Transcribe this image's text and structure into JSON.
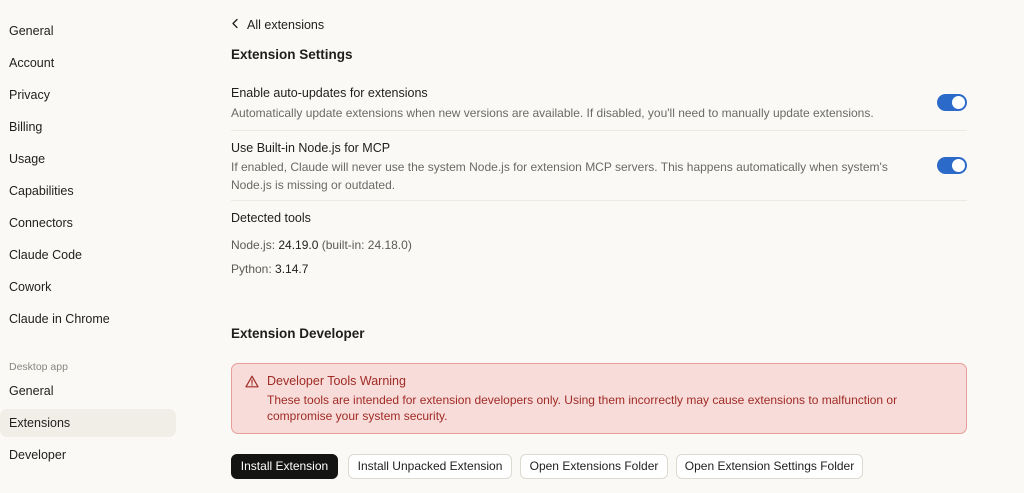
{
  "sidebar": {
    "items": [
      {
        "label": "General"
      },
      {
        "label": "Account"
      },
      {
        "label": "Privacy"
      },
      {
        "label": "Billing"
      },
      {
        "label": "Usage"
      },
      {
        "label": "Capabilities"
      },
      {
        "label": "Connectors"
      },
      {
        "label": "Claude Code"
      },
      {
        "label": "Cowork"
      },
      {
        "label": "Claude in Chrome"
      }
    ],
    "desktop_section_label": "Desktop app",
    "desktop_items": [
      {
        "label": "General"
      },
      {
        "label": "Extensions",
        "active": true
      },
      {
        "label": "Developer"
      }
    ]
  },
  "main": {
    "back_label": "All extensions",
    "settings_heading": "Extension Settings",
    "auto_updates": {
      "title": "Enable auto-updates for extensions",
      "description": "Automatically update extensions when new versions are available. If disabled, you'll need to manually update extensions.",
      "enabled": true
    },
    "builtin_node": {
      "title": "Use Built-in Node.js for MCP",
      "description": "If enabled, Claude will never use the system Node.js for extension MCP servers. This happens automatically when system's Node.js is missing or outdated.",
      "enabled": true
    },
    "detected_tools": {
      "label": "Detected tools",
      "node_label": "Node.js:",
      "node_version": "24.19.0",
      "node_builtin": "(built-in: 24.18.0)",
      "python_label": "Python:",
      "python_version": "3.14.7"
    },
    "developer_heading": "Extension Developer",
    "warning": {
      "title": "Developer Tools Warning",
      "body": "These tools are intended for extension developers only. Using them incorrectly may cause extensions to malfunction or compromise your system security."
    },
    "buttons": {
      "install": "Install Extension",
      "install_unpacked": "Install Unpacked Extension",
      "open_folder": "Open Extensions Folder",
      "open_settings_folder": "Open Extension Settings Folder"
    }
  },
  "colors": {
    "background": "#faf9f5",
    "toggle_on": "#2c6ac9",
    "warning_bg": "#f7dcda",
    "warning_text": "#a12b25",
    "primary_button": "#141413"
  }
}
